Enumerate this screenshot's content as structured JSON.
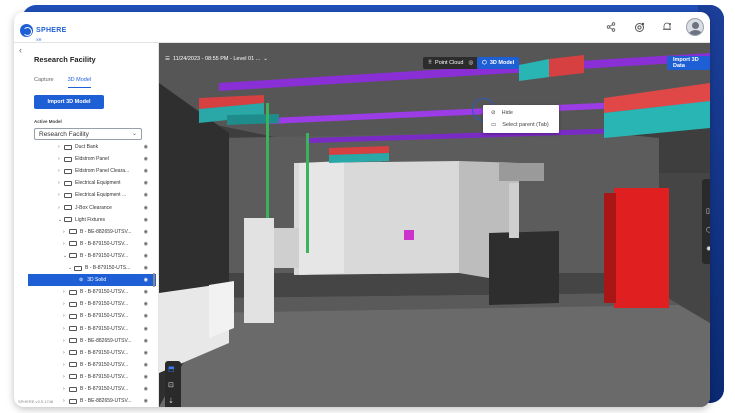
{
  "app": {
    "logo_text": "SPHERE",
    "logo_sub": "XR"
  },
  "header": {
    "icons": [
      "share-icon",
      "settings-icon",
      "notification-icon",
      "profile-avatar"
    ]
  },
  "sidebar": {
    "title": "Research Facility",
    "tabs": [
      {
        "label": "Capture",
        "active": false
      },
      {
        "label": "3D Model",
        "active": true
      }
    ],
    "import_button": "Import 3D Model",
    "active_model_label": "Active Model",
    "active_model_value": "Research Facility",
    "tree": [
      {
        "label": "Duct Bank",
        "indent": 1,
        "expanded": false,
        "selected": false
      },
      {
        "label": "Eldstrom Panel",
        "indent": 1,
        "expanded": false,
        "selected": false
      },
      {
        "label": "Eldstrom Panel Cleara...",
        "indent": 1,
        "expanded": false,
        "selected": false
      },
      {
        "label": "Electrical Equipment",
        "indent": 1,
        "expanded": false,
        "selected": false
      },
      {
        "label": "Electrical Equipment ...",
        "indent": 1,
        "expanded": false,
        "selected": false
      },
      {
        "label": "J-Box Clearance",
        "indent": 1,
        "expanded": false,
        "selected": false
      },
      {
        "label": "Light Fixtures",
        "indent": 1,
        "expanded": true,
        "selected": false
      },
      {
        "label": "B - BE-882659-UTSV...",
        "indent": 2,
        "expanded": false,
        "selected": false
      },
      {
        "label": "B - B-879150-UTSV...",
        "indent": 2,
        "expanded": false,
        "selected": false
      },
      {
        "label": "B - B-879150-UTSV...",
        "indent": 2,
        "expanded": true,
        "selected": false
      },
      {
        "label": "B - B-879150-UTS...",
        "indent": 3,
        "expanded": true,
        "selected": false
      },
      {
        "label": "3D Solid",
        "indent": 4,
        "expanded": false,
        "selected": true
      },
      {
        "label": "B - B-879150-UTSV...",
        "indent": 2,
        "expanded": false,
        "selected": false
      },
      {
        "label": "B - B-879150-UTSV...",
        "indent": 2,
        "expanded": false,
        "selected": false
      },
      {
        "label": "B - B-879150-UTSV...",
        "indent": 2,
        "expanded": false,
        "selected": false
      },
      {
        "label": "B - B-879150-UTSV...",
        "indent": 2,
        "expanded": false,
        "selected": false
      },
      {
        "label": "B - BE-882659-UTSV...",
        "indent": 2,
        "expanded": false,
        "selected": false
      },
      {
        "label": "B - B-879150-UTSV...",
        "indent": 2,
        "expanded": false,
        "selected": false
      },
      {
        "label": "B - B-879150-UTSV...",
        "indent": 2,
        "expanded": false,
        "selected": false
      },
      {
        "label": "B - B-879150-UTSV...",
        "indent": 2,
        "expanded": false,
        "selected": false
      },
      {
        "label": "B - B-879150-UTSV...",
        "indent": 2,
        "expanded": false,
        "selected": false
      },
      {
        "label": "B - BE-882659-UTSV...",
        "indent": 2,
        "expanded": false,
        "selected": false
      }
    ],
    "version": "SPHERE v3.5.1748"
  },
  "viewport": {
    "capture_info": "11/24/2023 - 08:55 PM - Level 01 ...",
    "point_cloud_label": "Point Cloud",
    "model_label": "3D Model",
    "import_data_button": "Import 3D Data",
    "context_menu": [
      {
        "label": "Hide",
        "icon": "eye-off-icon"
      },
      {
        "label": "Select parent (Tab)",
        "icon": "select-parent-icon"
      }
    ]
  },
  "colors": {
    "brand": "#1f5fd6",
    "frame": "#1f4fb8"
  }
}
